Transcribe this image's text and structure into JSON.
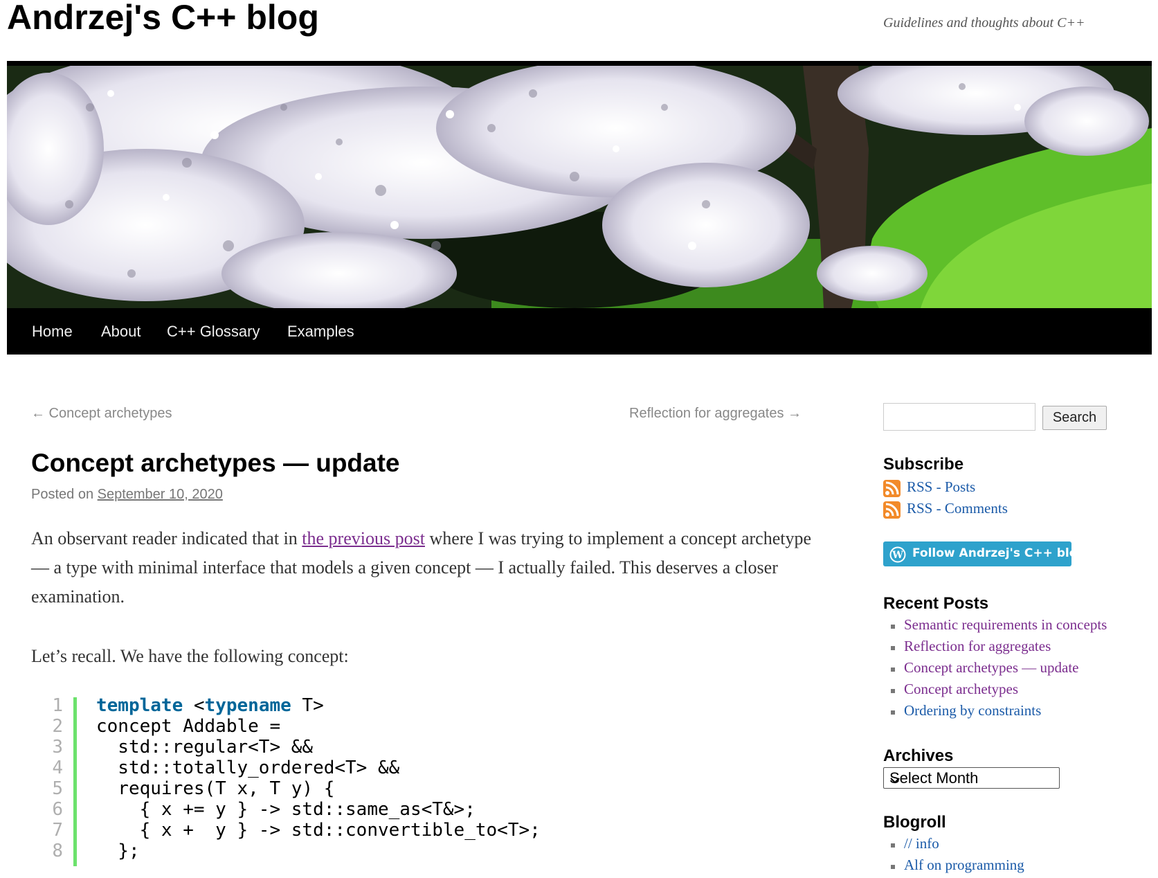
{
  "header": {
    "site_title": "Andrzej's C++ blog",
    "tagline": "Guidelines and thoughts about C++"
  },
  "hero": {
    "image": "cherry-blossom-tree-photo"
  },
  "nav": [
    "Home",
    "About",
    "C++ Glossary",
    "Examples"
  ],
  "post_nav": {
    "prev": "← Concept archetypes",
    "next": "Reflection for aggregates →"
  },
  "post": {
    "title": "Concept archetypes — update",
    "posted_prefix": "Posted on ",
    "date": "September 10, 2020",
    "p1_before": "An observant reader indicated that in ",
    "p1_link": "the previous post",
    "p1_after": " where I was trying to implement a concept archetype — a type with minimal interface that models a given concept — I actually failed. This deserves a closer examination.",
    "p2": "Let’s recall. We have the following concept:",
    "code": [
      {
        "n": "1",
        "parts": [
          {
            "t": "template",
            "kw": true
          },
          {
            "t": " <"
          },
          {
            "t": "typename",
            "kw": true
          },
          {
            "t": " T>"
          }
        ]
      },
      {
        "n": "2",
        "parts": [
          {
            "t": "concept Addable ="
          }
        ]
      },
      {
        "n": "3",
        "parts": [
          {
            "t": "  std::regular<T> &&"
          }
        ]
      },
      {
        "n": "4",
        "parts": [
          {
            "t": "  std::totally_ordered<T> &&"
          }
        ]
      },
      {
        "n": "5",
        "parts": [
          {
            "t": "  requires(T x, T y) {"
          }
        ]
      },
      {
        "n": "6",
        "parts": [
          {
            "t": "    { x += y } -> std::same_as<T&>;"
          }
        ]
      },
      {
        "n": "7",
        "parts": [
          {
            "t": "    { x +  y } -> std::convertible_to<T>;"
          }
        ]
      },
      {
        "n": "8",
        "parts": [
          {
            "t": "  };"
          }
        ]
      }
    ]
  },
  "sidebar": {
    "search_button": "Search",
    "search_placeholder": "",
    "subscribe_title": "Subscribe",
    "rss_posts": "RSS - Posts",
    "rss_comments": "RSS - Comments",
    "follow_label": "Follow Andrzej's C++ blog",
    "recent_title": "Recent Posts",
    "recent": [
      {
        "label": "Semantic requirements in concepts",
        "visited": true
      },
      {
        "label": "Reflection for aggregates",
        "visited": true
      },
      {
        "label": "Concept archetypes — update",
        "visited": true
      },
      {
        "label": "Concept archetypes",
        "visited": true
      },
      {
        "label": "Ordering by constraints",
        "visited": false
      }
    ],
    "archives_title": "Archives",
    "archives_select": "Select Month",
    "blogroll_title": "Blogroll",
    "blogroll": [
      "// info",
      "Alf on programming"
    ]
  },
  "colors": {
    "link": "#1a5aa8",
    "visited": "#7b2d8e",
    "nav_bg": "#000000",
    "follow_bg": "#2ea2cc",
    "code_bar": "#6ce26c",
    "keyword": "#006699"
  }
}
